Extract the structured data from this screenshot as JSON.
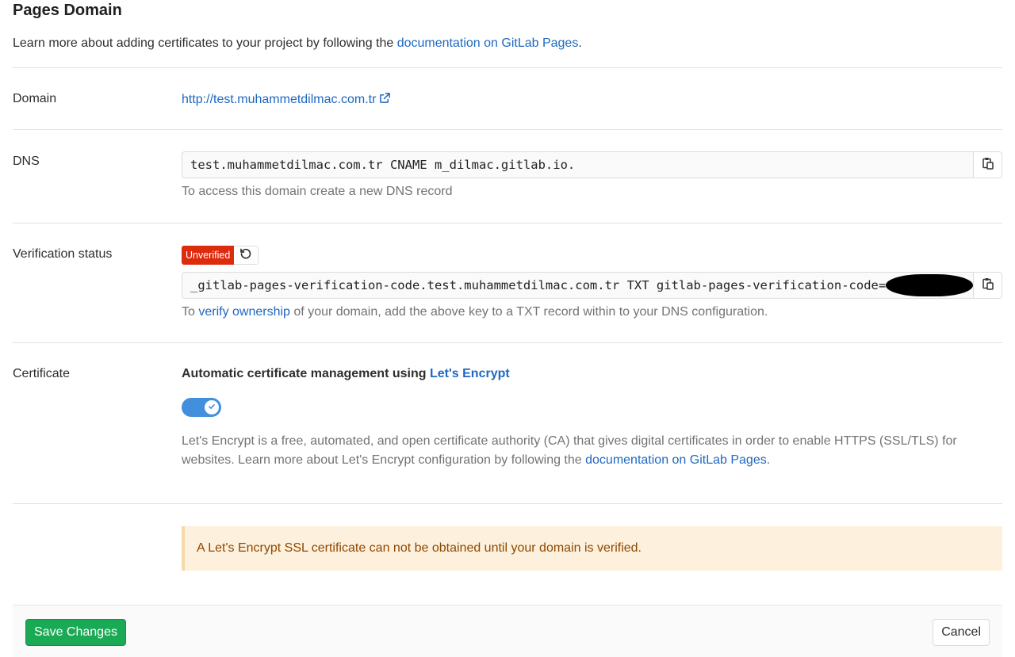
{
  "page": {
    "title": "Pages Domain",
    "intro_prefix": "Learn more about adding certificates to your project by following the ",
    "intro_link": "documentation on GitLab Pages",
    "intro_suffix": "."
  },
  "domain": {
    "label": "Domain",
    "url": "http://test.muhammetdilmac.com.tr",
    "icon": "external-link-icon"
  },
  "dns": {
    "label": "DNS",
    "record": "test.muhammetdilmac.com.tr CNAME m_dilmac.gitlab.io.",
    "help": "To access this domain create a new DNS record",
    "copy_icon": "clipboard-icon"
  },
  "verification": {
    "label": "Verification status",
    "badge": "Unverified",
    "retry_icon": "retry-icon",
    "record": "_gitlab-pages-verification-code.test.muhammetdilmac.com.tr TXT gitlab-pages-verification-code=",
    "help_prefix": "To ",
    "help_link": "verify ownership",
    "help_suffix": " of your domain, add the above key to a TXT record within to your DNS configuration.",
    "copy_icon": "clipboard-icon"
  },
  "certificate": {
    "label": "Certificate",
    "heading_prefix": "Automatic certificate management using ",
    "heading_link": "Let's Encrypt",
    "toggle_on": true,
    "desc_prefix": "Let's Encrypt is a free, automated, and open certificate authority (CA) that gives digital certificates in order to enable HTTPS (SSL/TLS) for websites. Learn more about Let's Encrypt configuration by following the ",
    "desc_link": "documentation on GitLab Pages",
    "desc_suffix": "."
  },
  "alert": {
    "message": "A Let's Encrypt SSL certificate can not be obtained until your domain is verified."
  },
  "footer": {
    "save_label": "Save Changes",
    "cancel_label": "Cancel"
  },
  "colors": {
    "link": "#1f68c1",
    "badge_danger": "#dd2b0e",
    "toggle_on": "#428fdc",
    "save_button": "#1aaa55",
    "alert_bg": "#fdf1dd",
    "alert_text": "#8f4700"
  }
}
